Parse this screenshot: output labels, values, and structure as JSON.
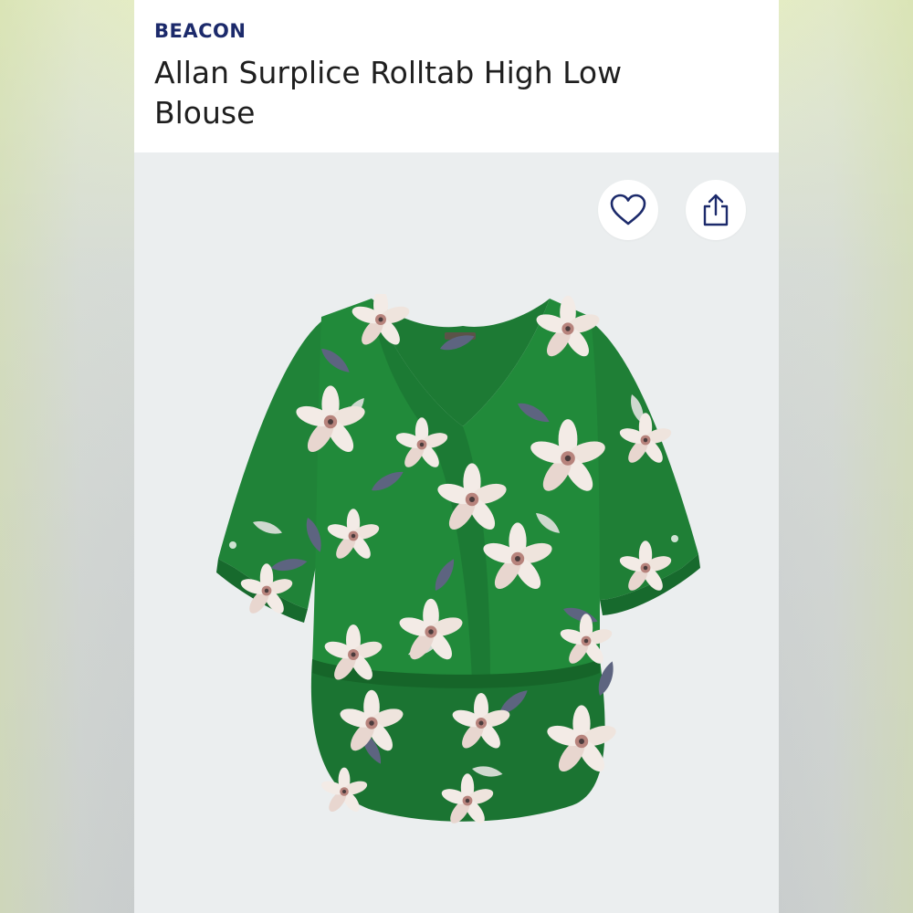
{
  "product": {
    "brand": "BEACON",
    "title": "Allan Surplice Rolltab High Low Blouse"
  },
  "actions": {
    "favorite_icon": "heart-icon",
    "share_icon": "share-icon"
  },
  "colors": {
    "brand_text": "#1c2a6b",
    "blouse_green": "#1e7e36",
    "flower_cream": "#f1e8e2",
    "flower_pink": "#d9b2ae",
    "leaf_slate": "#5d6480"
  }
}
